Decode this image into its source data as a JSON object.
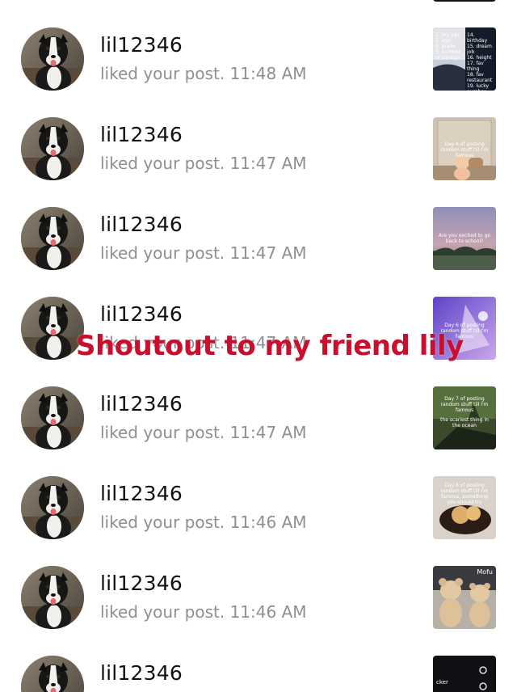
{
  "notifications": [
    {
      "username": "lil12346",
      "activity": "liked your post. 11:48 AM",
      "thumb_theme": "list",
      "thumb_text": "",
      "thumb_right_top": "14. birthday\n15. dream job\n16. height\n17. fav thing\n18. fav restaurant\n19. lucky number\n20. hobbies",
      "thumb_left": "1. my age\n2. age\n3. grade\n5. number of siblings"
    },
    {
      "username": "lil12346",
      "activity": "liked your post. 11:47 AM",
      "thumb_theme": "doll",
      "thumb_text": "Day 4 of posting random stuff till I'm famous"
    },
    {
      "username": "lil12346",
      "activity": "liked your post. 11:47 AM",
      "thumb_theme": "sky",
      "thumb_text": "Are you excited to go back to school?"
    },
    {
      "username": "lil12346",
      "activity": "liked your post. 11:47 AM",
      "thumb_theme": "purple",
      "thumb_text": "Day 6 of posting random stuff till I'm famous"
    },
    {
      "username": "lil12346",
      "activity": "liked your post. 11:47 AM",
      "thumb_theme": "forest",
      "thumb_text": "Day 7 of posting random stuff till I'm famous",
      "thumb_text2": "the scariest thing in the ocean"
    },
    {
      "username": "lil12346",
      "activity": "liked your post. 11:46 AM",
      "thumb_theme": "food",
      "thumb_text": "Day 8 of posting random stuff till I'm famous, something you should try"
    },
    {
      "username": "lil12346",
      "activity": "liked your post. 11:46 AM",
      "thumb_theme": "bears",
      "thumb_text": "Mofu"
    },
    {
      "username": "lil12346",
      "activity": "",
      "thumb_theme": "dark",
      "thumb_text": "cker"
    }
  ],
  "overlay_text": "Shoutout to my friend lily",
  "colors": {
    "username": "#111111",
    "activity": "#8e8e93",
    "overlay": "#c8102e",
    "background": "#ffffff"
  },
  "icons": {
    "avatar": "dog-avatar-icon"
  }
}
